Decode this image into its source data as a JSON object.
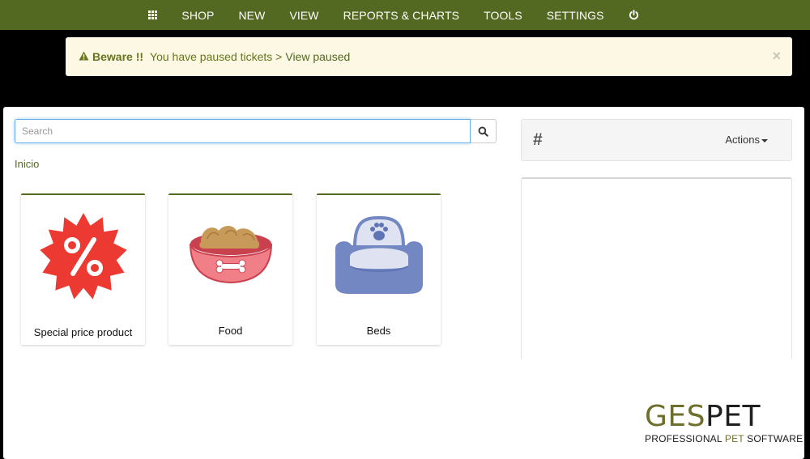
{
  "nav": {
    "items": [
      {
        "label": "SHOP"
      },
      {
        "label": "NEW"
      },
      {
        "label": "VIEW"
      },
      {
        "label": "REPORTS & CHARTS"
      },
      {
        "label": "TOOLS"
      },
      {
        "label": "SETTINGS"
      }
    ],
    "grid_icon": "grid-icon",
    "power_icon": "power-icon"
  },
  "alert": {
    "title": "Beware !!",
    "message": "You have paused tickets >",
    "link": "View paused",
    "close": "×",
    "icon": "warning-icon"
  },
  "search": {
    "placeholder": "Search",
    "value": "",
    "icon": "search-icon"
  },
  "breadcrumb": "Inicio",
  "categories": [
    {
      "label": "Special price product",
      "icon": "discount-badge-icon"
    },
    {
      "label": "Food",
      "icon": "pet-food-bowl-icon"
    },
    {
      "label": "Beds",
      "icon": "pet-bed-icon"
    }
  ],
  "ticket": {
    "hash": "#",
    "actions_label": "Actions"
  },
  "logo": {
    "ges": "GES",
    "pet": "PET",
    "tag_pre": "PROFESSIONAL ",
    "tag_pet": "PET",
    "tag_post": " SOFTWARE"
  },
  "colors": {
    "brand": "#536821",
    "alert_bg": "#fcf8e3",
    "alert_text": "#67751f",
    "badge_red": "#e53935",
    "bowl_pink": "#ef7d86",
    "bed_blue": "#7388c2"
  }
}
